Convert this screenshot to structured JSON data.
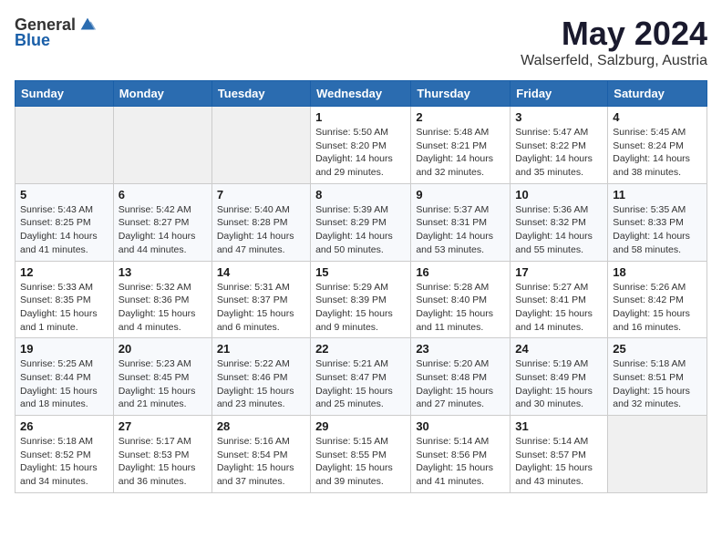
{
  "header": {
    "logo_general": "General",
    "logo_blue": "Blue",
    "title": "May 2024",
    "location": "Walserfeld, Salzburg, Austria"
  },
  "weekdays": [
    "Sunday",
    "Monday",
    "Tuesday",
    "Wednesday",
    "Thursday",
    "Friday",
    "Saturday"
  ],
  "weeks": [
    [
      {
        "day": "",
        "info": ""
      },
      {
        "day": "",
        "info": ""
      },
      {
        "day": "",
        "info": ""
      },
      {
        "day": "1",
        "info": "Sunrise: 5:50 AM\nSunset: 8:20 PM\nDaylight: 14 hours\nand 29 minutes."
      },
      {
        "day": "2",
        "info": "Sunrise: 5:48 AM\nSunset: 8:21 PM\nDaylight: 14 hours\nand 32 minutes."
      },
      {
        "day": "3",
        "info": "Sunrise: 5:47 AM\nSunset: 8:22 PM\nDaylight: 14 hours\nand 35 minutes."
      },
      {
        "day": "4",
        "info": "Sunrise: 5:45 AM\nSunset: 8:24 PM\nDaylight: 14 hours\nand 38 minutes."
      }
    ],
    [
      {
        "day": "5",
        "info": "Sunrise: 5:43 AM\nSunset: 8:25 PM\nDaylight: 14 hours\nand 41 minutes."
      },
      {
        "day": "6",
        "info": "Sunrise: 5:42 AM\nSunset: 8:27 PM\nDaylight: 14 hours\nand 44 minutes."
      },
      {
        "day": "7",
        "info": "Sunrise: 5:40 AM\nSunset: 8:28 PM\nDaylight: 14 hours\nand 47 minutes."
      },
      {
        "day": "8",
        "info": "Sunrise: 5:39 AM\nSunset: 8:29 PM\nDaylight: 14 hours\nand 50 minutes."
      },
      {
        "day": "9",
        "info": "Sunrise: 5:37 AM\nSunset: 8:31 PM\nDaylight: 14 hours\nand 53 minutes."
      },
      {
        "day": "10",
        "info": "Sunrise: 5:36 AM\nSunset: 8:32 PM\nDaylight: 14 hours\nand 55 minutes."
      },
      {
        "day": "11",
        "info": "Sunrise: 5:35 AM\nSunset: 8:33 PM\nDaylight: 14 hours\nand 58 minutes."
      }
    ],
    [
      {
        "day": "12",
        "info": "Sunrise: 5:33 AM\nSunset: 8:35 PM\nDaylight: 15 hours\nand 1 minute."
      },
      {
        "day": "13",
        "info": "Sunrise: 5:32 AM\nSunset: 8:36 PM\nDaylight: 15 hours\nand 4 minutes."
      },
      {
        "day": "14",
        "info": "Sunrise: 5:31 AM\nSunset: 8:37 PM\nDaylight: 15 hours\nand 6 minutes."
      },
      {
        "day": "15",
        "info": "Sunrise: 5:29 AM\nSunset: 8:39 PM\nDaylight: 15 hours\nand 9 minutes."
      },
      {
        "day": "16",
        "info": "Sunrise: 5:28 AM\nSunset: 8:40 PM\nDaylight: 15 hours\nand 11 minutes."
      },
      {
        "day": "17",
        "info": "Sunrise: 5:27 AM\nSunset: 8:41 PM\nDaylight: 15 hours\nand 14 minutes."
      },
      {
        "day": "18",
        "info": "Sunrise: 5:26 AM\nSunset: 8:42 PM\nDaylight: 15 hours\nand 16 minutes."
      }
    ],
    [
      {
        "day": "19",
        "info": "Sunrise: 5:25 AM\nSunset: 8:44 PM\nDaylight: 15 hours\nand 18 minutes."
      },
      {
        "day": "20",
        "info": "Sunrise: 5:23 AM\nSunset: 8:45 PM\nDaylight: 15 hours\nand 21 minutes."
      },
      {
        "day": "21",
        "info": "Sunrise: 5:22 AM\nSunset: 8:46 PM\nDaylight: 15 hours\nand 23 minutes."
      },
      {
        "day": "22",
        "info": "Sunrise: 5:21 AM\nSunset: 8:47 PM\nDaylight: 15 hours\nand 25 minutes."
      },
      {
        "day": "23",
        "info": "Sunrise: 5:20 AM\nSunset: 8:48 PM\nDaylight: 15 hours\nand 27 minutes."
      },
      {
        "day": "24",
        "info": "Sunrise: 5:19 AM\nSunset: 8:49 PM\nDaylight: 15 hours\nand 30 minutes."
      },
      {
        "day": "25",
        "info": "Sunrise: 5:18 AM\nSunset: 8:51 PM\nDaylight: 15 hours\nand 32 minutes."
      }
    ],
    [
      {
        "day": "26",
        "info": "Sunrise: 5:18 AM\nSunset: 8:52 PM\nDaylight: 15 hours\nand 34 minutes."
      },
      {
        "day": "27",
        "info": "Sunrise: 5:17 AM\nSunset: 8:53 PM\nDaylight: 15 hours\nand 36 minutes."
      },
      {
        "day": "28",
        "info": "Sunrise: 5:16 AM\nSunset: 8:54 PM\nDaylight: 15 hours\nand 37 minutes."
      },
      {
        "day": "29",
        "info": "Sunrise: 5:15 AM\nSunset: 8:55 PM\nDaylight: 15 hours\nand 39 minutes."
      },
      {
        "day": "30",
        "info": "Sunrise: 5:14 AM\nSunset: 8:56 PM\nDaylight: 15 hours\nand 41 minutes."
      },
      {
        "day": "31",
        "info": "Sunrise: 5:14 AM\nSunset: 8:57 PM\nDaylight: 15 hours\nand 43 minutes."
      },
      {
        "day": "",
        "info": ""
      }
    ]
  ]
}
